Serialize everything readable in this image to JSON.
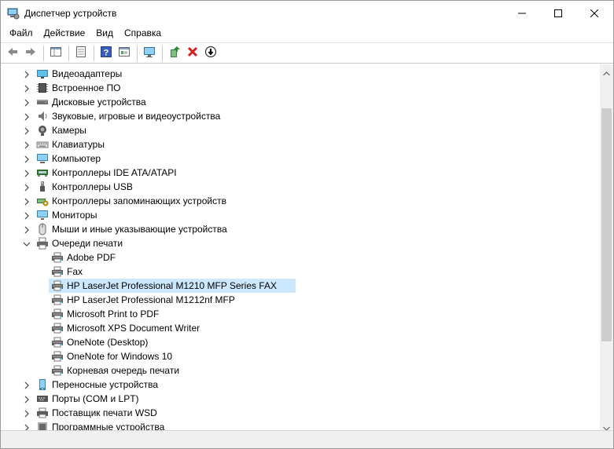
{
  "window": {
    "title": "Диспетчер устройств"
  },
  "menu": [
    "Файл",
    "Действие",
    "Вид",
    "Справка"
  ],
  "toolbar": {
    "buttons": [
      "back-arrow-icon",
      "forward-arrow-icon",
      "properties-pane-icon",
      "show-hide-icon",
      "help-icon",
      "device-props-icon",
      "monitor-scan-icon",
      "update-driver-icon",
      "uninstall-icon",
      "disable-device-icon"
    ]
  },
  "tree": {
    "rows": [
      {
        "label": "Видеоадаптеры",
        "icon": "display-adapter-icon",
        "expanded": false,
        "depth": 0
      },
      {
        "label": "Встроенное ПО",
        "icon": "firmware-chip-icon",
        "expanded": false,
        "depth": 0
      },
      {
        "label": "Дисковые устройства",
        "icon": "disk-drive-icon",
        "expanded": false,
        "depth": 0
      },
      {
        "label": "Звуковые, игровые и видеоустройства",
        "icon": "speaker-icon",
        "expanded": false,
        "depth": 0
      },
      {
        "label": "Камеры",
        "icon": "camera-icon",
        "expanded": false,
        "depth": 0
      },
      {
        "label": "Клавиатуры",
        "icon": "keyboard-icon",
        "expanded": false,
        "depth": 0
      },
      {
        "label": "Компьютер",
        "icon": "computer-icon",
        "expanded": false,
        "depth": 0
      },
      {
        "label": "Контроллеры IDE ATA/ATAPI",
        "icon": "ide-controller-icon",
        "expanded": false,
        "depth": 0
      },
      {
        "label": "Контроллеры USB",
        "icon": "usb-icon",
        "expanded": false,
        "depth": 0
      },
      {
        "label": "Контроллеры запоминающих устройств",
        "icon": "storage-controller-icon",
        "expanded": false,
        "depth": 0
      },
      {
        "label": "Мониторы",
        "icon": "monitor-icon",
        "expanded": false,
        "depth": 0
      },
      {
        "label": "Мыши и иные указывающие устройства",
        "icon": "mouse-icon",
        "expanded": false,
        "depth": 0
      },
      {
        "label": "Очереди печати",
        "icon": "print-queue-icon",
        "expanded": true,
        "depth": 0
      },
      {
        "label": "Adobe PDF",
        "icon": "printer-icon",
        "depth": 1
      },
      {
        "label": "Fax",
        "icon": "printer-icon",
        "depth": 1
      },
      {
        "label": "HP LaserJet Professional M1210 MFP Series FAX",
        "icon": "printer-icon",
        "depth": 1,
        "selected": true
      },
      {
        "label": "HP LaserJet Professional M1212nf MFP",
        "icon": "printer-icon",
        "depth": 1
      },
      {
        "label": "Microsoft Print to PDF",
        "icon": "printer-icon",
        "depth": 1
      },
      {
        "label": "Microsoft XPS Document Writer",
        "icon": "printer-icon",
        "depth": 1
      },
      {
        "label": "OneNote (Desktop)",
        "icon": "printer-icon",
        "depth": 1
      },
      {
        "label": "OneNote for Windows 10",
        "icon": "printer-icon",
        "depth": 1
      },
      {
        "label": "Корневая очередь печати",
        "icon": "printer-icon",
        "depth": 1
      },
      {
        "label": "Переносные устройства",
        "icon": "portable-device-icon",
        "expanded": false,
        "depth": 0
      },
      {
        "label": "Порты (COM и LPT)",
        "icon": "port-icon",
        "expanded": false,
        "depth": 0
      },
      {
        "label": "Поставщик печати WSD",
        "icon": "wsd-printer-icon",
        "expanded": false,
        "depth": 0
      },
      {
        "label": "Программные устройства",
        "icon": "software-device-icon",
        "expanded": false,
        "depth": 0
      }
    ]
  },
  "colors": {
    "selection": "#cce8ff",
    "accent": "#0078d7"
  }
}
